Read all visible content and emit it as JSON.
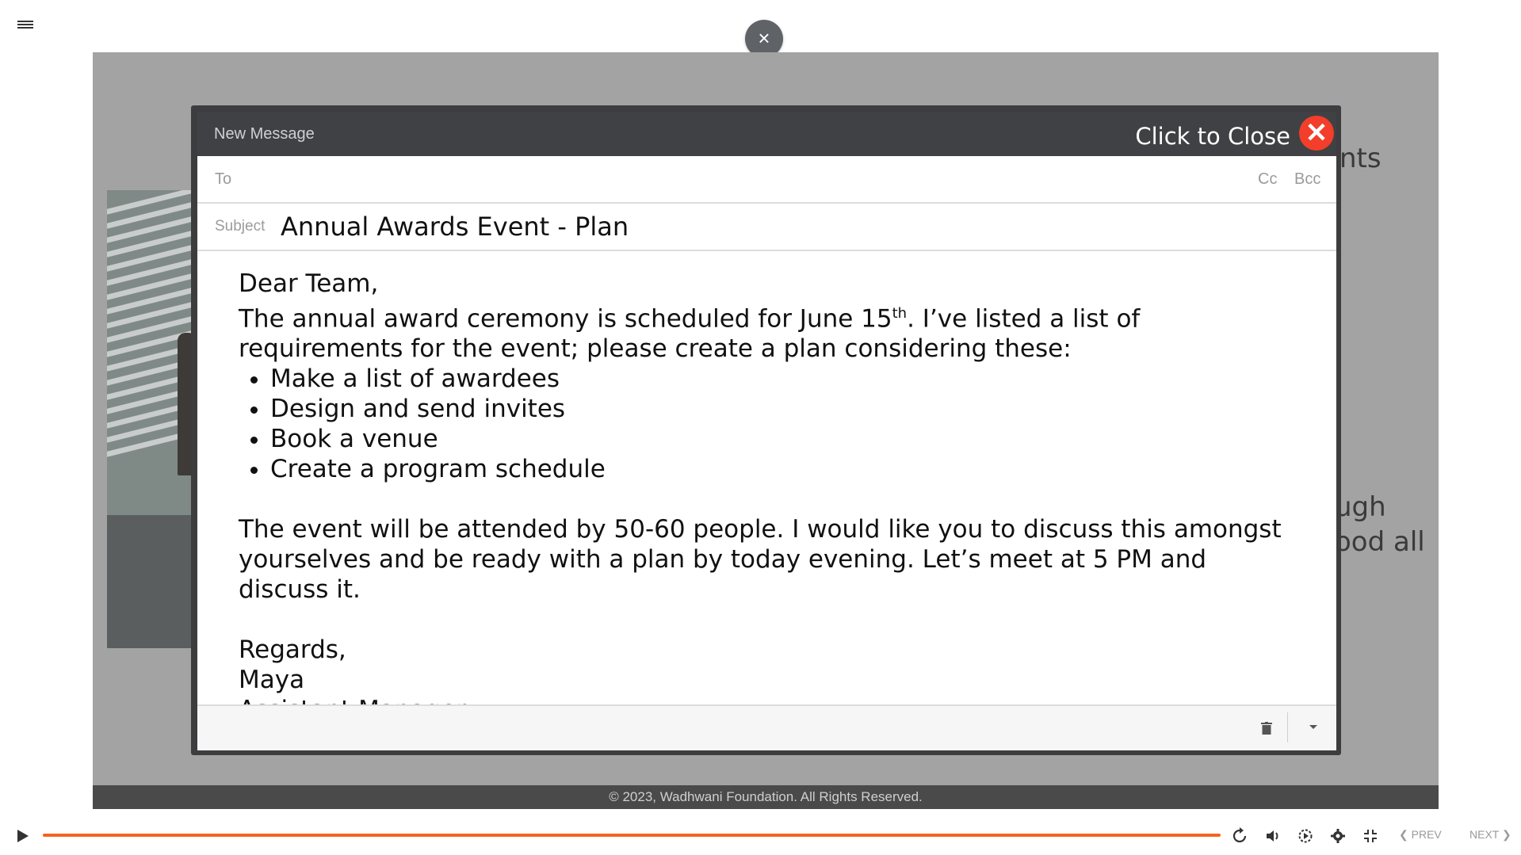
{
  "top": {
    "close_symbol": "×"
  },
  "background": {
    "text_line_1": "nts",
    "text_line_2": "ugh",
    "text_line_3": "ood all"
  },
  "footer": {
    "copyright": "© 2023, Wadhwani Foundation. All Rights Reserved."
  },
  "email": {
    "window_title": "New Message",
    "close_label": "Click to Close",
    "close_symbol": "✕",
    "to_label": "To",
    "cc_label": "Cc",
    "bcc_label": "Bcc",
    "subject_label": "Subject",
    "subject_value": "Annual Awards Event - Plan",
    "body": {
      "greeting": "Dear Team,",
      "intro_part1": "The annual award ceremony is scheduled for June 15",
      "intro_sup": "th",
      "intro_part2": ". I’ve listed a list of requirements for the event; please create a plan considering these:",
      "requirements": [
        "Make a list of awardees",
        "Design and send invites",
        "Book a venue",
        "Create a program schedule"
      ],
      "paragraph": "The event will be attended by 50-60 people. I would like you to discuss this amongst yourselves and be ready with a plan by today evening. Let’s meet at 5 PM and discuss it.",
      "closing": "Regards,",
      "signature_name": "Maya",
      "signature_title": "Assistant Manager"
    }
  },
  "player": {
    "progress_fraction": 1.0,
    "accent_color": "#f26522",
    "prev_label": "PREV",
    "next_label": "NEXT"
  }
}
